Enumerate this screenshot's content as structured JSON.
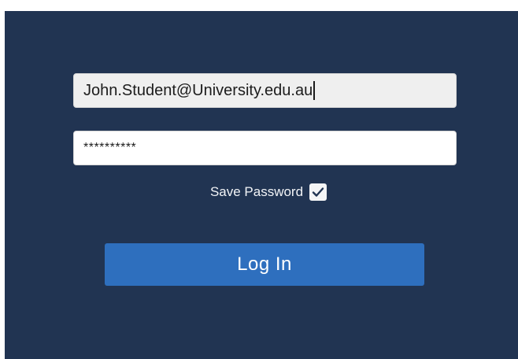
{
  "login": {
    "email_value": "John.Student@University.edu.au",
    "password_value": "**********",
    "save_password_label": "Save Password",
    "save_password_checked": true,
    "login_button_label": "Log In"
  },
  "colors": {
    "panel_background": "#213452",
    "button_background": "#2e6fbe",
    "email_field_background": "#efefef",
    "password_field_background": "#ffffff"
  },
  "icons": {
    "checkbox": "check-icon"
  }
}
